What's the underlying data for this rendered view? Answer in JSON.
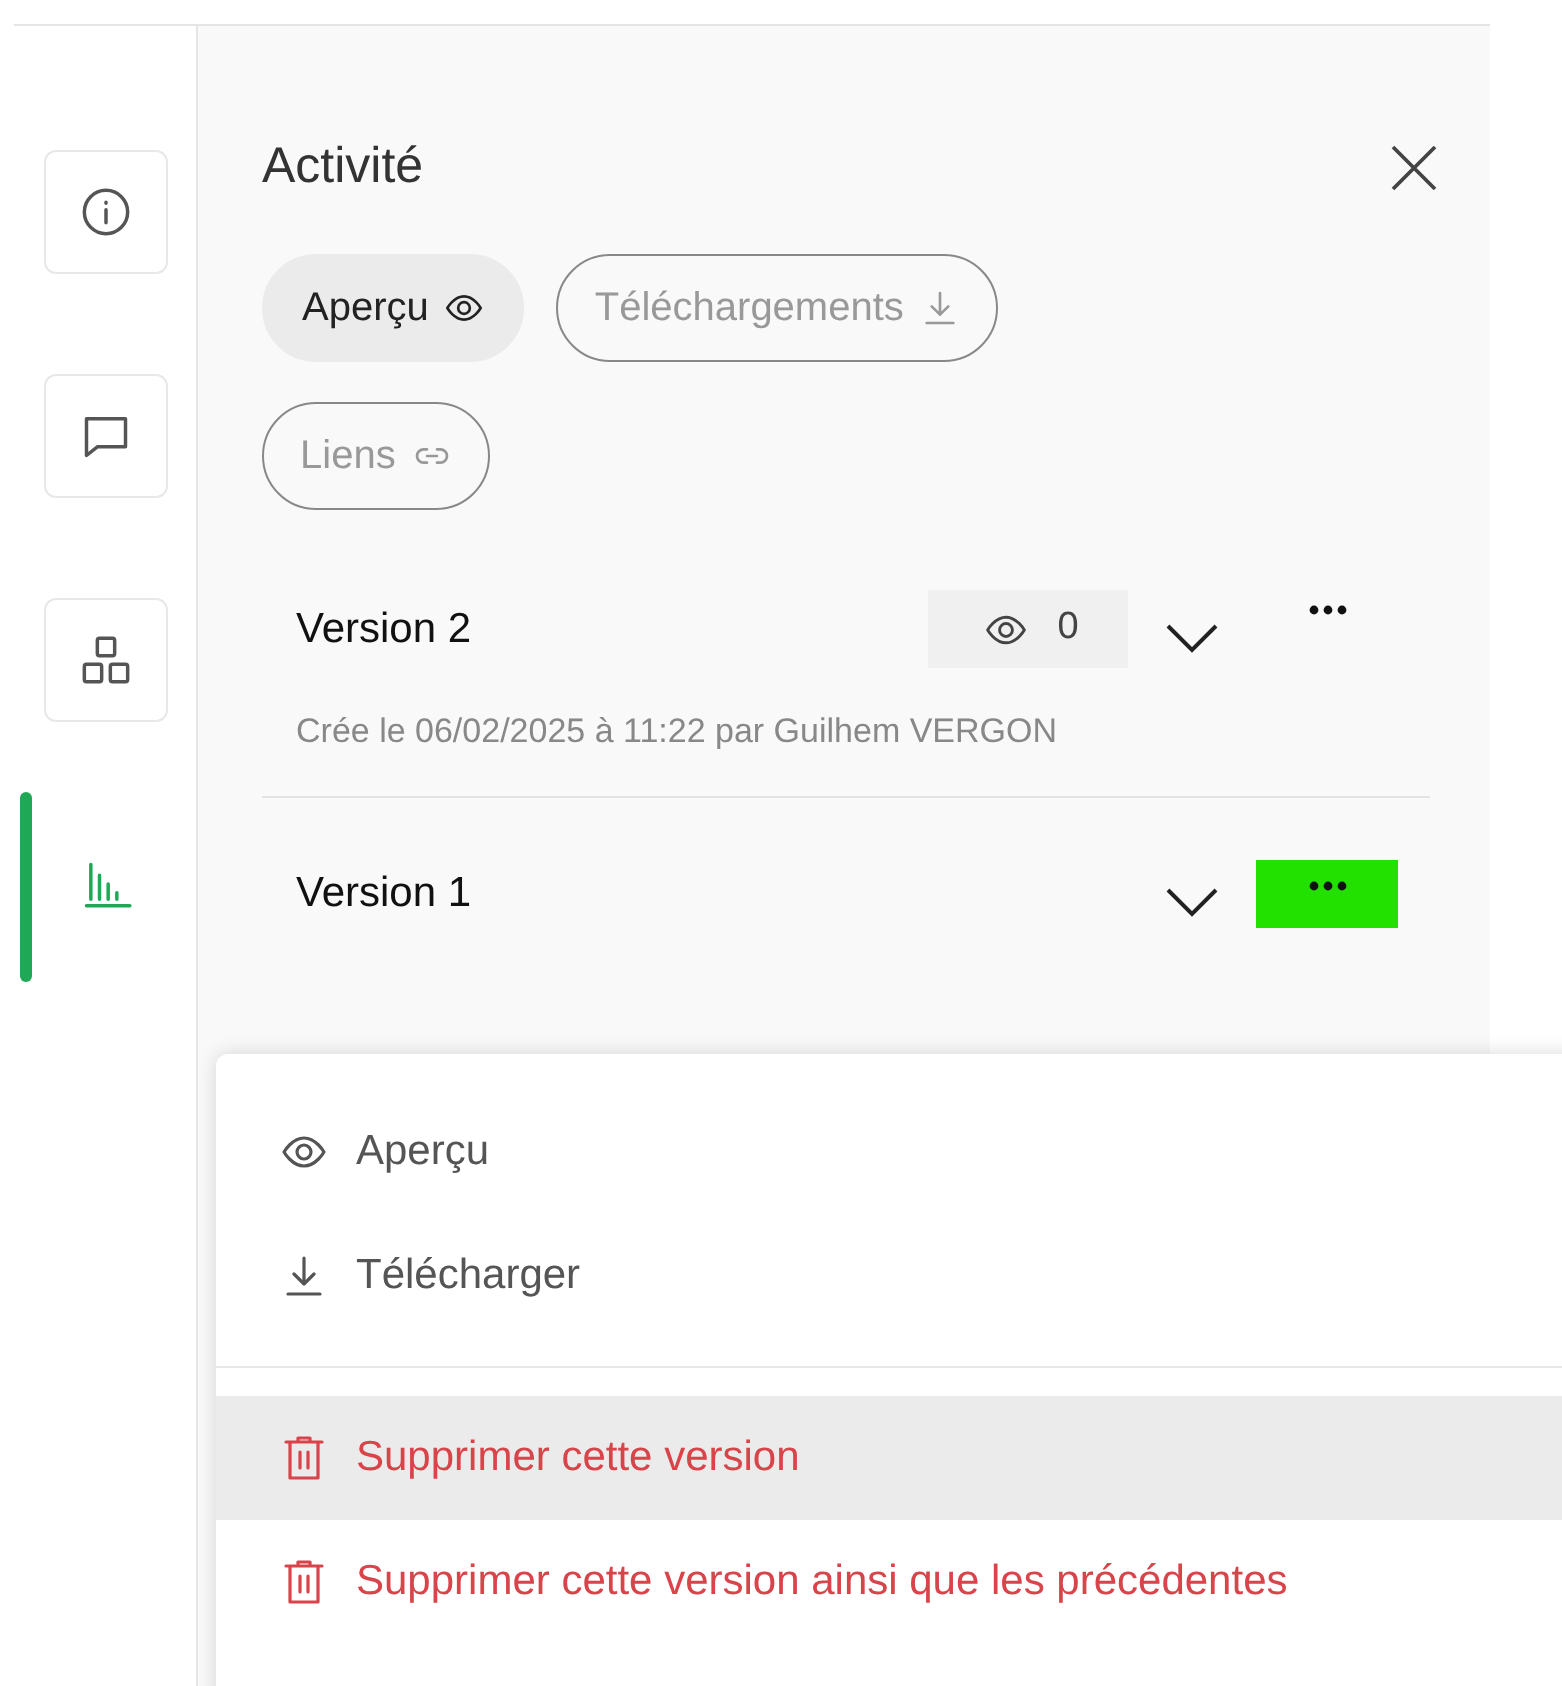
{
  "sidebar": {
    "items": [
      {
        "kind": "info",
        "selected": false
      },
      {
        "kind": "comment",
        "selected": false
      },
      {
        "kind": "apps",
        "selected": false
      },
      {
        "kind": "chart",
        "selected": true
      }
    ]
  },
  "panel": {
    "title": "Activité",
    "filters": [
      {
        "label": "Aperçu",
        "kind": "eye",
        "selected": true
      },
      {
        "label": "Téléchargements",
        "kind": "download",
        "selected": false
      },
      {
        "label": "Liens",
        "kind": "link",
        "selected": false
      }
    ],
    "versions": [
      {
        "title": "Version 2",
        "views": "0",
        "subtitle": "Crée le 06/02/2025 à 11:22 par Guilhem VERGON",
        "menu_open": false
      },
      {
        "title": "Version 1",
        "menu_open": true
      }
    ]
  },
  "menu": {
    "items": [
      {
        "label": "Aperçu",
        "kind": "eye",
        "danger": false,
        "selected": false
      },
      {
        "label": "Télécharger",
        "kind": "download",
        "danger": false,
        "selected": false
      },
      {
        "label": "Supprimer cette version",
        "kind": "trash",
        "danger": true,
        "selected": true
      },
      {
        "label": "Supprimer cette version ainsi que les précédentes",
        "kind": "trash",
        "danger": true,
        "selected": false
      }
    ]
  }
}
